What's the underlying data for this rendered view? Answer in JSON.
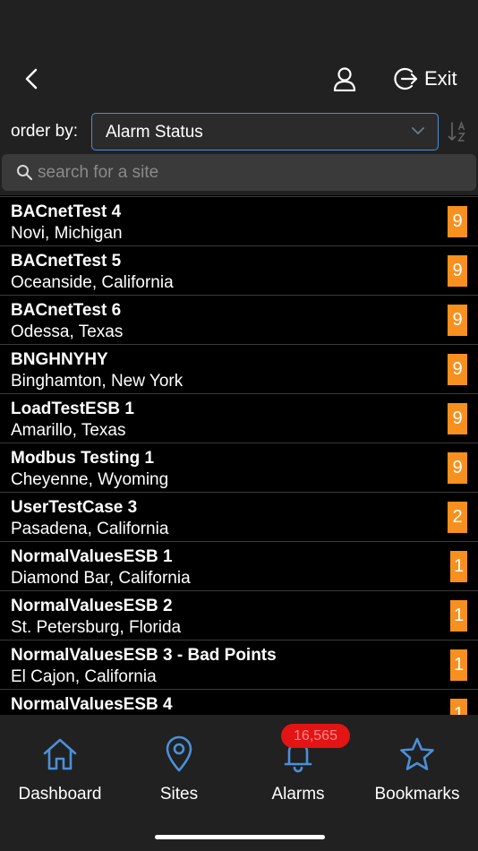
{
  "header": {
    "exit_label": "Exit"
  },
  "order": {
    "label": "order by:",
    "selected": "Alarm Status"
  },
  "search": {
    "placeholder": "search for a site"
  },
  "sites": [
    {
      "name": "BACnetTest 4",
      "location": "Novi, Michigan",
      "alarms": "9"
    },
    {
      "name": "BACnetTest 5",
      "location": "Oceanside, California",
      "alarms": "9"
    },
    {
      "name": "BACnetTest 6",
      "location": "Odessa, Texas",
      "alarms": "9"
    },
    {
      "name": "BNGHNYHY",
      "location": "Binghamton, New York",
      "alarms": "9"
    },
    {
      "name": "LoadTestESB 1",
      "location": "Amarillo, Texas",
      "alarms": "9"
    },
    {
      "name": "Modbus Testing 1",
      "location": "Cheyenne, Wyoming",
      "alarms": "9"
    },
    {
      "name": "UserTestCase 3",
      "location": "Pasadena, California",
      "alarms": "2"
    },
    {
      "name": "NormalValuesESB 1",
      "location": "Diamond Bar, California",
      "alarms": "1"
    },
    {
      "name": "NormalValuesESB 2",
      "location": "St. Petersburg, Florida",
      "alarms": "1"
    },
    {
      "name": "NormalValuesESB 3 - Bad Points",
      "location": "El Cajon, California",
      "alarms": "1"
    },
    {
      "name": "NormalValuesESB 4",
      "location": "",
      "alarms": "1"
    }
  ],
  "tabs": [
    {
      "label": "Dashboard",
      "icon": "home-icon"
    },
    {
      "label": "Sites",
      "icon": "location-pin-icon"
    },
    {
      "label": "Alarms",
      "icon": "bell-icon",
      "badge": "16,565"
    },
    {
      "label": "Bookmarks",
      "icon": "star-icon"
    }
  ],
  "colors": {
    "accent": "#4a90d9",
    "badge": "#f7901e",
    "alarm_badge": "#e31414",
    "bar": "#212121"
  }
}
